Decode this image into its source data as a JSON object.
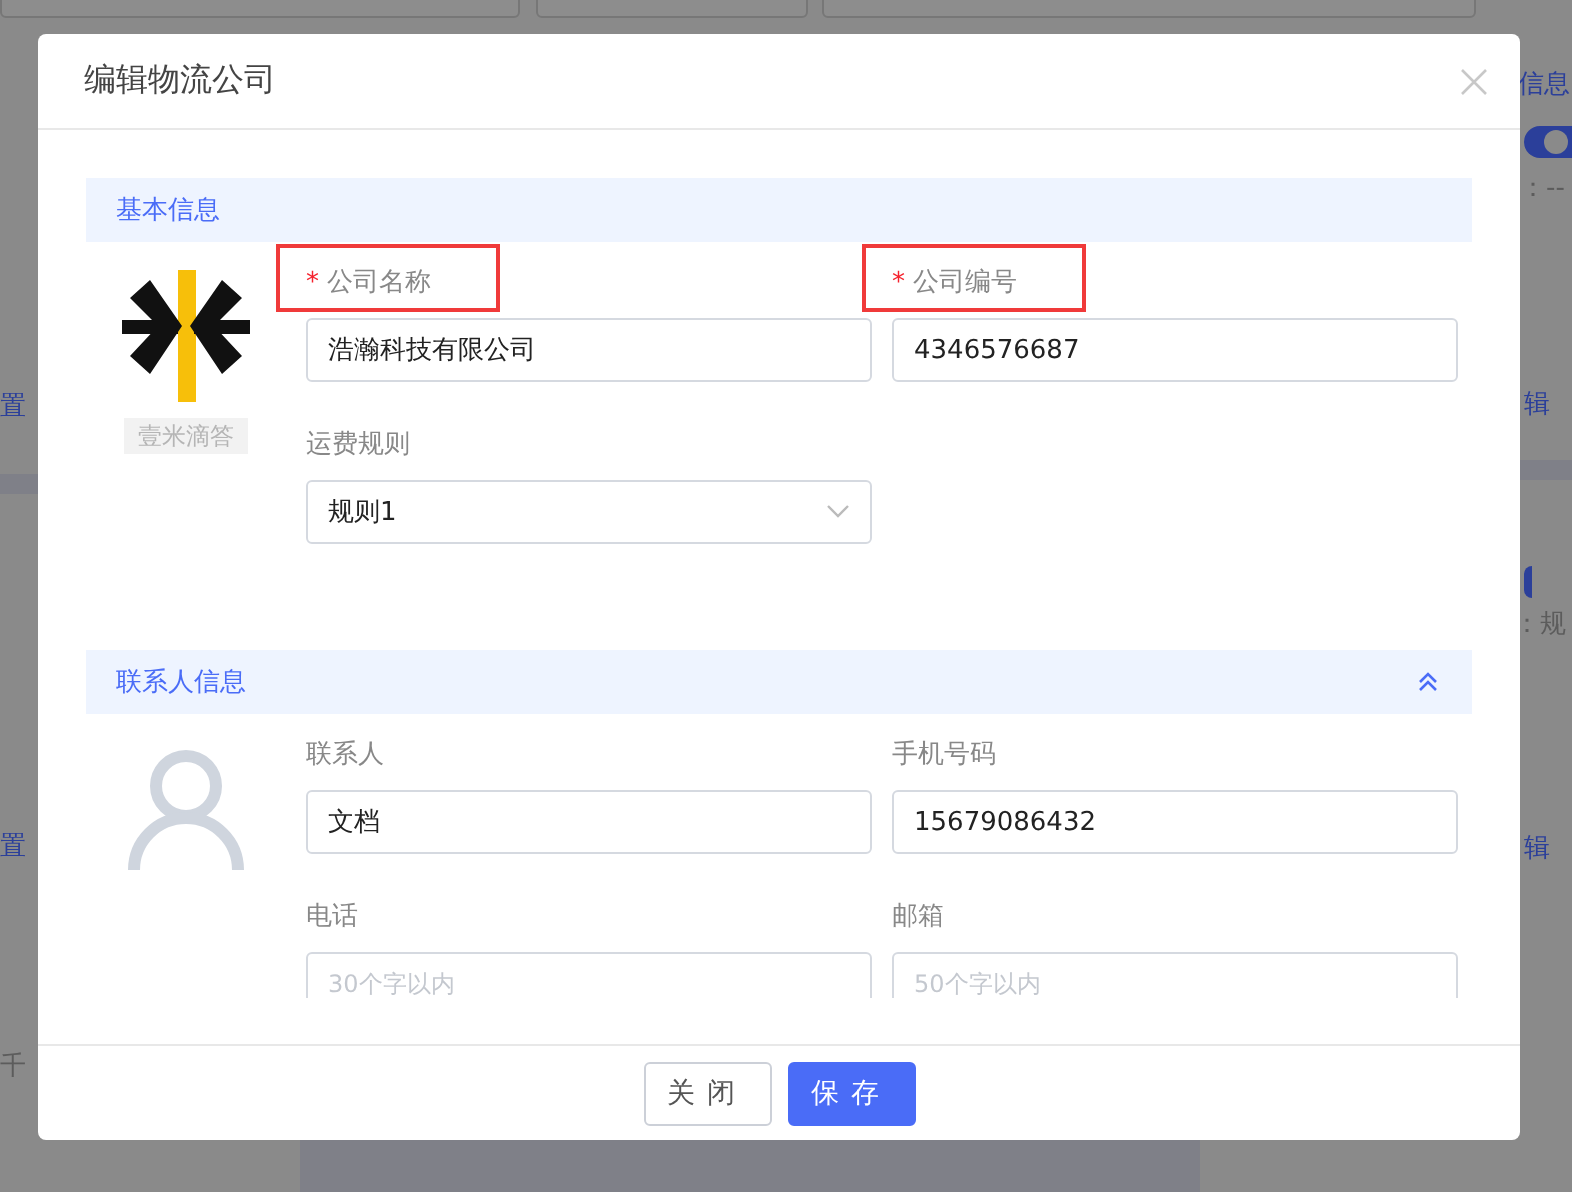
{
  "background": {
    "right_texts": [
      "信息",
      "：--",
      "辑",
      "：规",
      "辑"
    ],
    "left_texts": [
      "置",
      "置",
      "千"
    ],
    "toggles": [
      {
        "on": true
      },
      {
        "on": true
      }
    ]
  },
  "dialog": {
    "title": "编辑物流公司",
    "required_mark": "*",
    "sections": [
      {
        "kind": "basic",
        "title": "基本信息",
        "logo_caption": "壹米滴答",
        "fields": [
          {
            "kind": "input",
            "label": "公司名称",
            "required": true,
            "highlighted": true,
            "value": "浩瀚科技有限公司"
          },
          {
            "kind": "input",
            "label": "公司编号",
            "required": true,
            "highlighted": true,
            "value": "4346576687"
          },
          {
            "kind": "select",
            "label": "运费规则",
            "required": false,
            "highlighted": false,
            "value": "规则1"
          }
        ]
      },
      {
        "kind": "contact",
        "title": "联系人信息",
        "expanded": true,
        "fields": [
          {
            "kind": "input",
            "label": "联系人",
            "required": false,
            "highlighted": false,
            "value": "文档"
          },
          {
            "kind": "input",
            "label": "手机号码",
            "required": false,
            "highlighted": false,
            "value": "15679086432"
          },
          {
            "kind": "input",
            "label": "电话",
            "required": false,
            "highlighted": false,
            "placeholder": "30个字以内"
          },
          {
            "kind": "input",
            "label": "邮箱",
            "required": false,
            "highlighted": false,
            "placeholder": "50个字以内"
          }
        ]
      }
    ],
    "buttons": [
      {
        "kind": "secondary",
        "label": "关闭"
      },
      {
        "kind": "primary",
        "label": "保存"
      }
    ]
  }
}
